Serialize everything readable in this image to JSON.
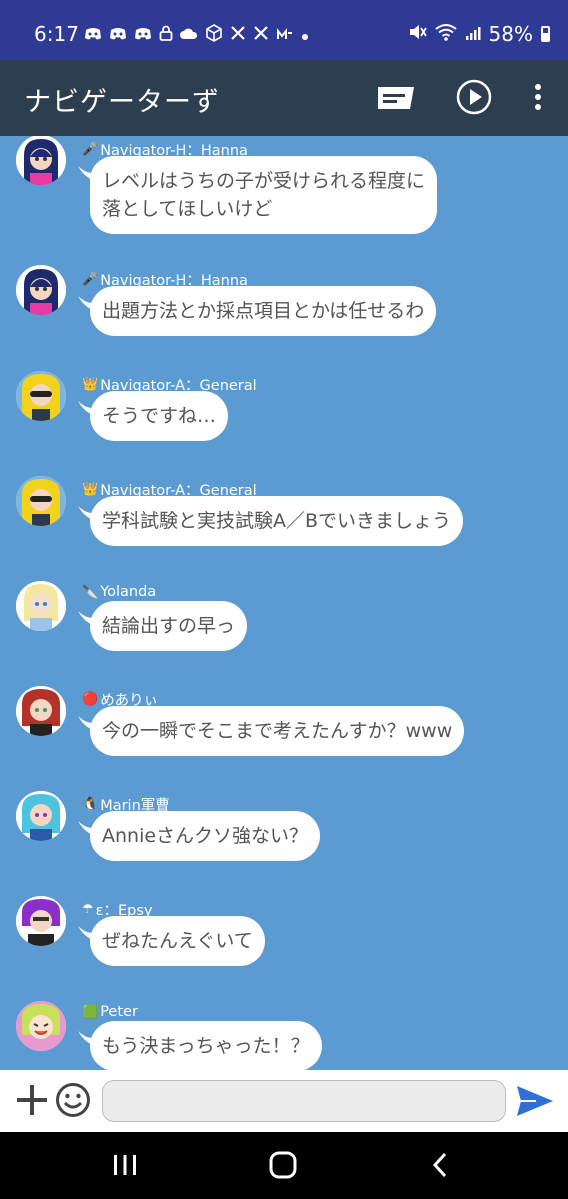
{
  "status_bar": {
    "time": "6:17",
    "notification_icons": [
      "discord-icon",
      "discord-icon",
      "discord-icon",
      "lock-icon",
      "cloud-icon",
      "box-icon",
      "x-icon",
      "x-icon",
      "misskey-icon",
      "dot-icon"
    ],
    "battery": "58%"
  },
  "app_bar": {
    "title": "ナビゲーターず",
    "actions": [
      "flag-icon",
      "play-icon",
      "more-icon"
    ]
  },
  "messages": [
    {
      "sender": "Navigator-H：Hanna",
      "sender_icon": "🎤",
      "text": "レベルはうちの子が受けられる程度に\n落としてほしいけど",
      "avatar_color": "#1d2a6b"
    },
    {
      "sender": "Navigator-H：Hanna",
      "sender_icon": "🎤",
      "text": "出題方法とか採点項目とかは任せるわ",
      "avatar_color": "#1d2a6b"
    },
    {
      "sender": "Navigator-A：General",
      "sender_icon": "👑",
      "text": "そうですね…",
      "avatar_color": "#f2d21c"
    },
    {
      "sender": "Navigator-A：General",
      "sender_icon": "👑",
      "text": "学科試験と実技試験A／Bでいきましょう",
      "avatar_color": "#f2d21c"
    },
    {
      "sender": "Yolanda",
      "sender_icon": "🔪",
      "text": "結論出すの早っ",
      "avatar_color": "#f5e6a0"
    },
    {
      "sender": "めありぃ",
      "sender_icon": "🔴",
      "text": "今の一瞬でそこまで考えたんすか？www",
      "avatar_color": "#b2322c"
    },
    {
      "sender": "Marin軍曹",
      "sender_icon": "🐧",
      "text": "Annieさんクソ強ない？",
      "avatar_color": "#4cc4e0"
    },
    {
      "sender": "ε：Epsy",
      "sender_icon": "☂",
      "text": "ぜねたんえぐいて",
      "avatar_color": "#8a2fc9"
    },
    {
      "sender": "Peter",
      "sender_icon": "🟩",
      "text": "もう決まっちゃった！？",
      "avatar_color": "#c8e05a"
    }
  ],
  "composer": {
    "placeholder": "",
    "value": ""
  },
  "colors": {
    "status_bar": "#2e3a94",
    "app_bar": "#2c3e4f",
    "chat_bg": "#5b9bd2",
    "send": "#2f6fd6"
  }
}
